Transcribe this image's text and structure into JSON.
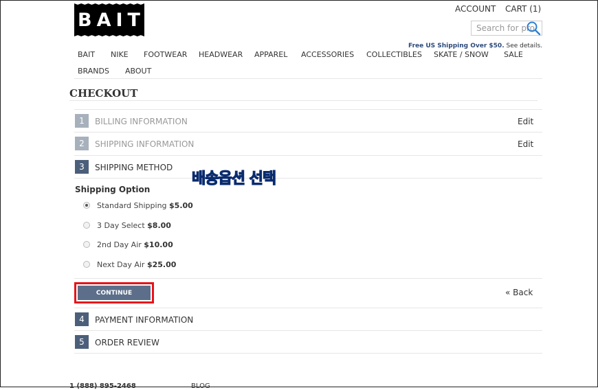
{
  "header": {
    "logo_text": "BAIT",
    "account_label": "ACCOUNT",
    "cart_label": "CART (1)",
    "search_placeholder": "Search for pro",
    "shipping_promo_bold": "Free US Shipping Over $50.",
    "shipping_promo_link": "See details."
  },
  "nav": {
    "items": [
      "BAIT",
      "NIKE",
      "FOOTWEAR",
      "HEADWEAR",
      "APPAREL",
      "ACCESSORIES",
      "COLLECTIBLES",
      "SKATE / SNOW",
      "SALE",
      "BRANDS",
      "ABOUT"
    ]
  },
  "checkout": {
    "title": "CHECKOUT",
    "steps": [
      {
        "num": "1",
        "label": "BILLING INFORMATION",
        "edit": "Edit"
      },
      {
        "num": "2",
        "label": "SHIPPING INFORMATION",
        "edit": "Edit"
      },
      {
        "num": "3",
        "label": "SHIPPING METHOD"
      },
      {
        "num": "4",
        "label": "PAYMENT INFORMATION"
      },
      {
        "num": "5",
        "label": "ORDER REVIEW"
      }
    ],
    "shipping_option_title": "Shipping Option",
    "options": [
      {
        "name": "Standard Shipping",
        "price": "$5.00",
        "selected": true
      },
      {
        "name": "3 Day Select",
        "price": "$8.00",
        "selected": false
      },
      {
        "name": "2nd Day Air",
        "price": "$10.00",
        "selected": false
      },
      {
        "name": "Next Day Air",
        "price": "$25.00",
        "selected": false
      }
    ],
    "continue_label": "CONTINUE",
    "back_label": "« Back"
  },
  "annotation": {
    "text": "배송옵션 선택",
    "color": "#4aa3e6",
    "highlight_color": "#e8121a"
  },
  "footer": {
    "phone": "1 (888) 895-2468",
    "blog": "BLOG"
  }
}
